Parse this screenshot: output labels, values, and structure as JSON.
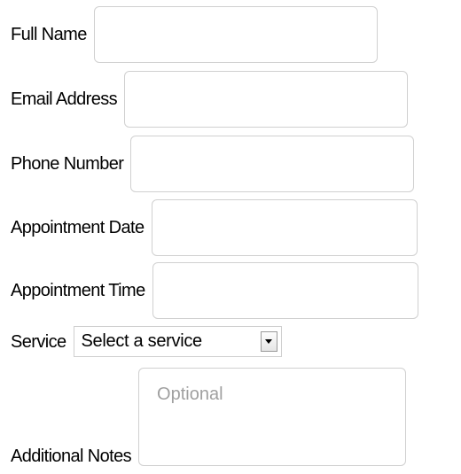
{
  "form": {
    "full_name": {
      "label": "Full Name",
      "value": ""
    },
    "email": {
      "label": "Email Address",
      "value": ""
    },
    "phone": {
      "label": "Phone Number",
      "value": ""
    },
    "appointment_date": {
      "label": "Appointment Date",
      "value": ""
    },
    "appointment_time": {
      "label": "Appointment Time",
      "value": ""
    },
    "service": {
      "label": "Service",
      "selected": "Select a service"
    },
    "notes": {
      "label": "Additional Notes",
      "placeholder": "Optional",
      "value": ""
    }
  },
  "colors": {
    "border": "#d0d0d0",
    "placeholder": "#a0a0a0"
  },
  "icons": {
    "select_arrow": "chevron-down-icon"
  }
}
